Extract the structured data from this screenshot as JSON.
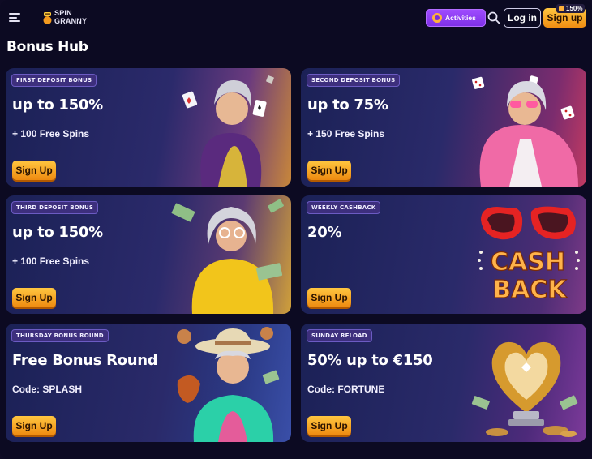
{
  "header": {
    "logo_line1": "SPIN",
    "logo_line2": "GRANNY",
    "activities_label": "Activities",
    "login_label": "Log in",
    "signup_label": "Sign up",
    "signup_badge": "150%"
  },
  "page": {
    "title": "Bonus Hub"
  },
  "colors": {
    "accent_purple": "#8b3cf2",
    "cta_orange": "#f5a623",
    "background": "#0c0a22"
  },
  "cards": [
    {
      "tag": "FIRST DEPOSIT BONUS",
      "headline": "up to 150%",
      "sub": "+ 100 Free Spins",
      "cta": "Sign Up"
    },
    {
      "tag": "SECOND DEPOSIT BONUS",
      "headline": "up to 75%",
      "sub": "+ 150 Free Spins",
      "cta": "Sign Up"
    },
    {
      "tag": "THIRD DEPOSIT BONUS",
      "headline": "up to 150%",
      "sub": "+ 100 Free Spins",
      "cta": "Sign Up"
    },
    {
      "tag": "WEEKLY CASHBACK",
      "headline": "20%",
      "sub": "",
      "cta": "Sign Up",
      "art_text_1": "CASH",
      "art_text_2": "BACK"
    },
    {
      "tag": "THURSDAY BONUS ROUND",
      "headline": "Free Bonus Round",
      "sub": "Code: SPLASH",
      "cta": "Sign Up"
    },
    {
      "tag": "SUNDAY RELOAD",
      "headline": "50% up to €150",
      "sub": "Code: FORTUNE",
      "cta": "Sign Up"
    }
  ]
}
